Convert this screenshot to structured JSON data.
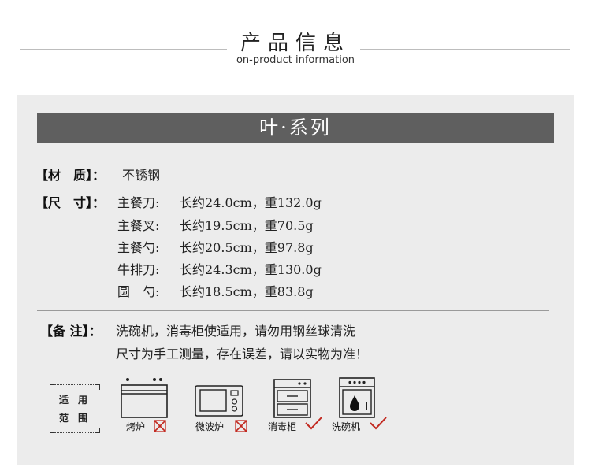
{
  "header": {
    "title": "产品信息",
    "subtitle": "on-product information"
  },
  "banner": {
    "title": "叶·系列"
  },
  "material": {
    "label": "【材　质】：",
    "value": "不锈钢"
  },
  "size": {
    "label": "【尺　寸】：",
    "items": [
      {
        "name": "主餐刀:",
        "spec": "长约24.0cm，重132.0g"
      },
      {
        "name": "主餐叉:",
        "spec": "长约19.5cm，重70.5g"
      },
      {
        "name": "主餐勺:",
        "spec": "长约20.5cm，重97.8g"
      },
      {
        "name": "牛排刀:",
        "spec": "长约24.3cm，重130.0g"
      },
      {
        "name": "圆　勺:",
        "spec": "长约18.5cm，重83.8g"
      }
    ]
  },
  "notes": {
    "label": "【备 注】：",
    "line1": "洗碗机，消毒柜使适用，请勿用钢丝球清洗",
    "line2": "尺寸为手工测量，存在误差，请以实物为准！"
  },
  "applicable": {
    "frame_text_1": "适　用",
    "frame_text_2": "范　围",
    "items": [
      {
        "label": "烤炉",
        "icon": "oven-icon",
        "status": "cross-icon",
        "ok": false
      },
      {
        "label": "微波炉",
        "icon": "microwave-icon",
        "status": "cross-icon",
        "ok": false
      },
      {
        "label": "消毒柜",
        "icon": "sterilizer-cabinet-icon",
        "status": "check-icon",
        "ok": true
      },
      {
        "label": "洗碗机",
        "icon": "dishwasher-icon",
        "status": "check-icon",
        "ok": true
      }
    ],
    "colors": {
      "cross": "#c2281f",
      "check": "#c2281f",
      "icon_stroke": "#222222"
    }
  }
}
